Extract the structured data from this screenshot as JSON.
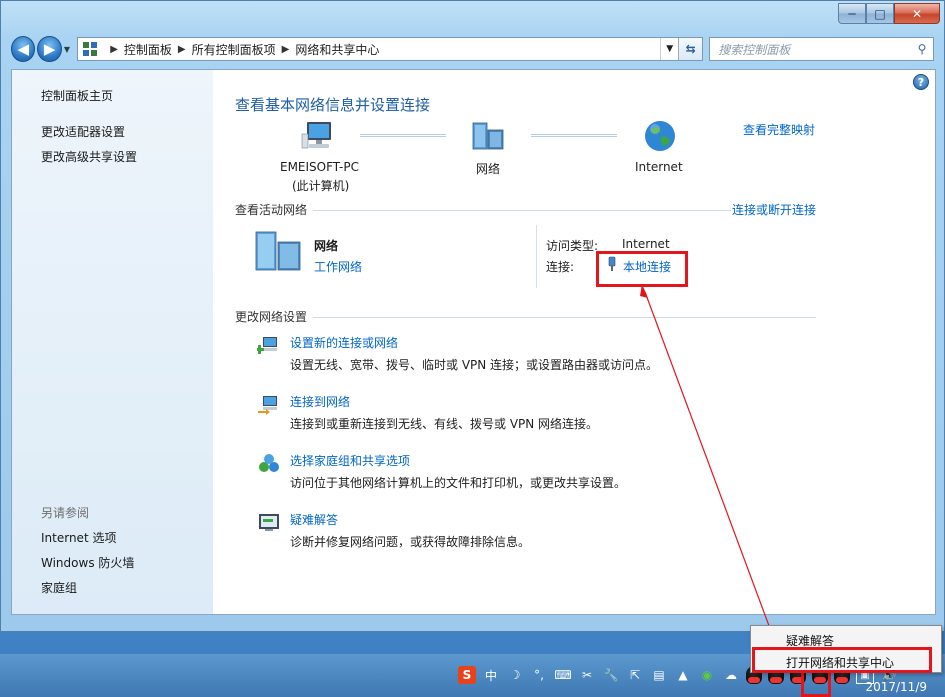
{
  "window": {
    "caption": {
      "minimize": "─",
      "maximize": "□",
      "close": "✕"
    }
  },
  "nav": {
    "back": "◀",
    "forward": "▶",
    "breadcrumb": [
      "控制面板",
      "所有控制面板项",
      "网络和共享中心"
    ],
    "search_placeholder": "搜索控制面板"
  },
  "sidebar": {
    "home": "控制面板主页",
    "items": [
      "更改适配器设置",
      "更改高级共享设置"
    ],
    "see_also_label": "另请参阅",
    "see_also": [
      "Internet 选项",
      "Windows 防火墙",
      "家庭组"
    ]
  },
  "main": {
    "title": "查看基本网络信息并设置连接",
    "view_full_map": "查看完整映射",
    "map": {
      "pc_name": "EMEISOFT-PC",
      "pc_sub": "(此计算机)",
      "network": "网络",
      "internet": "Internet"
    },
    "active_networks_label": "查看活动网络",
    "connect_disconnect": "连接或断开连接",
    "active_network": {
      "name": "网络",
      "type": "工作网络",
      "access_type_label": "访问类型:",
      "access_type_value": "Internet",
      "connection_label": "连接:",
      "connection_value": "本地连接"
    },
    "change_settings_label": "更改网络设置",
    "tasks": [
      {
        "title": "设置新的连接或网络",
        "desc": "设置无线、宽带、拨号、临时或 VPN 连接；或设置路由器或访问点。"
      },
      {
        "title": "连接到网络",
        "desc": "连接到或重新连接到无线、有线、拨号或 VPN 网络连接。"
      },
      {
        "title": "选择家庭组和共享选项",
        "desc": "访问位于其他网络计算机上的文件和打印机，或更改共享设置。"
      },
      {
        "title": "疑难解答",
        "desc": "诊断并修复网络问题，或获得故障排除信息。"
      }
    ]
  },
  "popup": {
    "items": [
      "疑难解答",
      "打开网络和共享中心"
    ]
  },
  "taskbar": {
    "ime_label": "中",
    "punct": "°,",
    "date": "2017/11/9"
  },
  "colors": {
    "link": "#0066cc",
    "title": "#1e5ea8",
    "highlight_box": "#e3161b",
    "sidebar_bg": "#e4eff9"
  }
}
